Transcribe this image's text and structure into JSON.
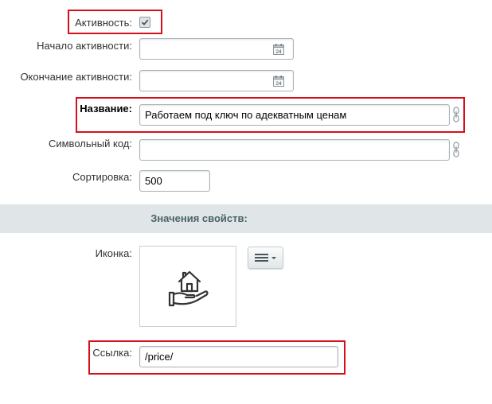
{
  "colors": {
    "highlight_border": "#d4101c",
    "section_bg": "#e0e6e8",
    "section_text": "#4b6267"
  },
  "fields": {
    "active": {
      "label": "Активность:",
      "checked": true
    },
    "active_from": {
      "label": "Начало активности:",
      "value": "",
      "icon": "calendar-icon",
      "calendar_day": "24"
    },
    "active_to": {
      "label": "Окончание активности:",
      "value": "",
      "icon": "calendar-icon",
      "calendar_day": "24"
    },
    "name": {
      "label": "Название:",
      "value": "Работаем под ключ по адекватным ценам",
      "icon": "link-chain-icon"
    },
    "code": {
      "label": "Символьный код:",
      "value": "",
      "icon": "link-chain-icon"
    },
    "sort": {
      "label": "Сортировка:",
      "value": "500"
    }
  },
  "properties": {
    "title": "Значения свойств:",
    "icon": {
      "label": "Иконка:",
      "image": "house-in-hand-icon",
      "menu_button": "menu-icon"
    },
    "link": {
      "label": "Ссылка:",
      "value": "/price/"
    }
  }
}
